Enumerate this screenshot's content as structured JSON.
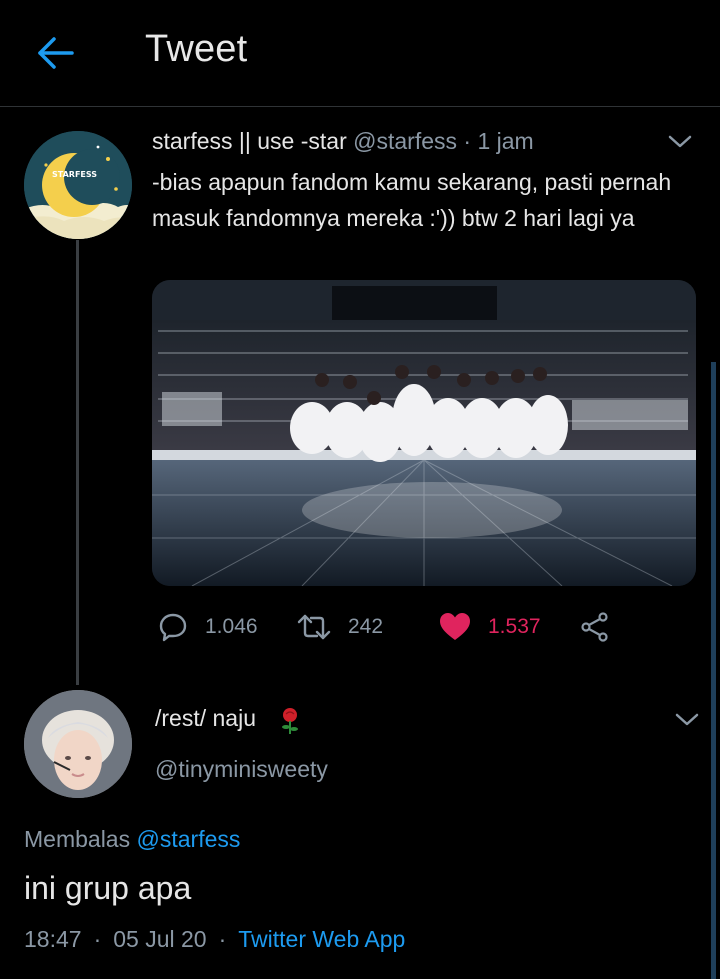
{
  "colors": {
    "background": "#000000",
    "accent": "#1d9bf0",
    "like": "#e0245e",
    "muted": "#8b98a5",
    "text": "#e6e6e6"
  },
  "header": {
    "back_icon": "arrow-left-icon",
    "title": "Tweet"
  },
  "tweet": {
    "avatar_label": "STARFESS",
    "display_name": "starfess || use -star",
    "handle": "@starfess",
    "dot": "·",
    "time": "1 jam",
    "menu_icon": "chevron-down-icon",
    "text": "-bias apapun fandom kamu sekarang, pasti pernah masuk fandomnya mereka :')) btw 2 hari lagi ya",
    "media": "photo of a music group in white outfits kneeling on a concert stage",
    "actions": {
      "reply_icon": "reply-bubble-icon",
      "replies": "1.046",
      "retweet_icon": "retweet-icon",
      "retweets": "242",
      "like_icon": "heart-filled-icon",
      "likes": "1.537",
      "share_icon": "share-icon"
    }
  },
  "reply": {
    "display_name": "/rest/ naju",
    "emoji_icon": "rose-icon",
    "handle": "@tinyminisweety",
    "menu_icon": "chevron-down-icon",
    "replying_prefix": "Membalas",
    "replying_to": "@starfess",
    "text": "ini grup apa",
    "time": "18:47",
    "date": "05 Jul 20",
    "source": "Twitter Web App",
    "dot": "·"
  }
}
